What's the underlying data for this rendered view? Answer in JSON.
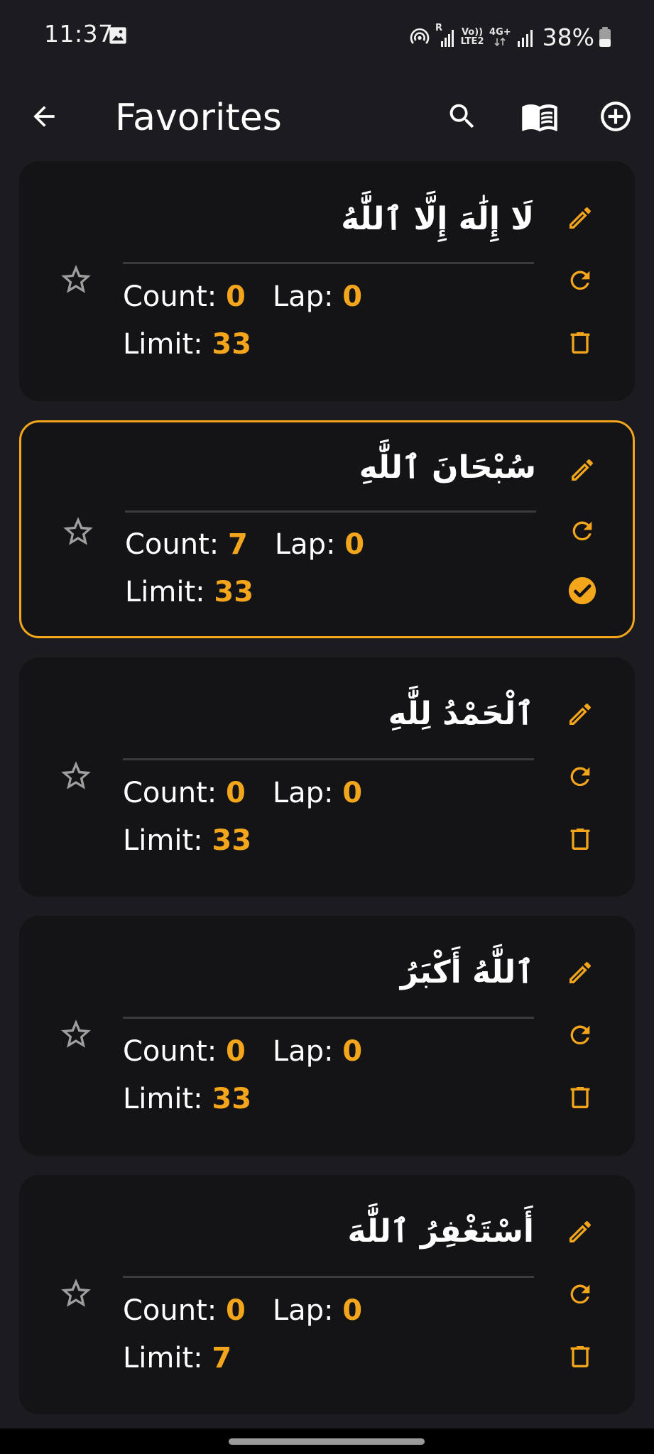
{
  "status_bar": {
    "time": "11:37",
    "battery": "38%",
    "volte_label": "Vo))\nLTE2",
    "network_label": "4G+",
    "roaming_label": "R",
    "icons": [
      "photo-icon",
      "hotspot-icon",
      "signal-icon",
      "signal-icon",
      "battery-icon"
    ]
  },
  "app_bar": {
    "title": "Favorites",
    "icons": [
      "back-arrow-icon",
      "search-icon",
      "book-icon",
      "add-circle-icon"
    ]
  },
  "labels": {
    "count": "Count: ",
    "lap": "Lap: ",
    "limit": "Limit: "
  },
  "cards": [
    {
      "text": "لَا إِلَٰهَ إِلَّا ٱللَّٰهُ",
      "count": "0",
      "lap": "0",
      "limit": "33",
      "selected": false,
      "third_action": "delete-icon"
    },
    {
      "text": "سُبْحَانَ ٱللَّٰهِ",
      "count": "7",
      "lap": "0",
      "limit": "33",
      "selected": true,
      "third_action": "check-circle-icon"
    },
    {
      "text": "ٱلْحَمْدُ لِلَّٰهِ",
      "count": "0",
      "lap": "0",
      "limit": "33",
      "selected": false,
      "third_action": "delete-icon"
    },
    {
      "text": "ٱللَّٰهُ أَكْبَرُ",
      "count": "0",
      "lap": "0",
      "limit": "33",
      "selected": false,
      "third_action": "delete-icon"
    },
    {
      "text": "أَسْتَغْفِرُ ٱللَّٰهَ",
      "count": "0",
      "lap": "0",
      "limit": "7",
      "selected": false,
      "third_action": "delete-icon"
    }
  ],
  "colors": {
    "background": "#1c1b1f",
    "card": "#141316",
    "accent": "#f3a51b",
    "divider": "#3b3a3f",
    "star_outline": "#9e9e9e"
  }
}
